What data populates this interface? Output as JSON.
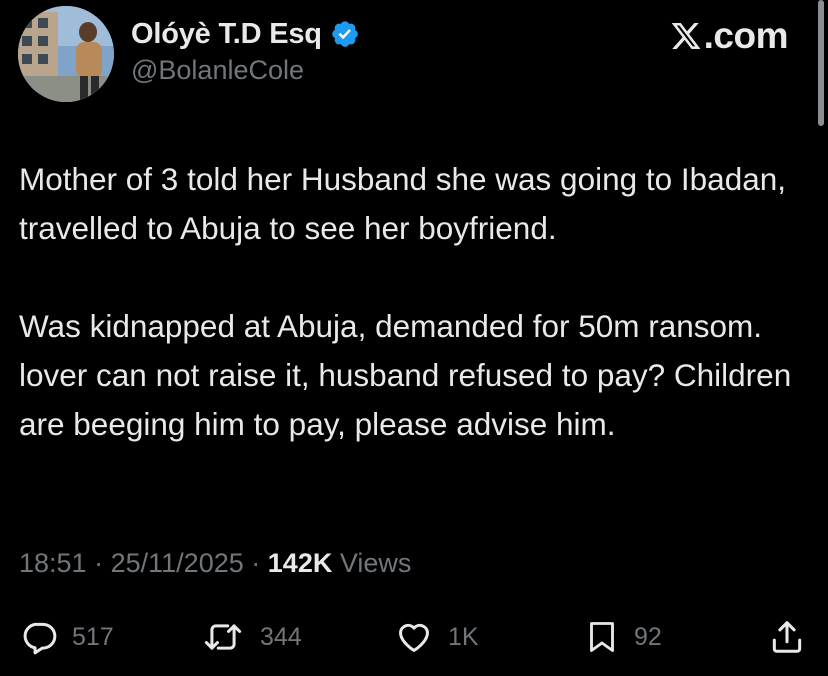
{
  "author": {
    "display_name": "Olóyè T.D Esq",
    "handle": "@BolanleCole",
    "verified": true,
    "avatar_icon": "profile-photo"
  },
  "brand": {
    "logo_icon": "x-logo-icon",
    "text": ".com"
  },
  "tweet": {
    "paragraphs": [
      "Mother of 3 told her Husband she was going to Ibadan, travelled to Abuja to see her boyfriend.",
      "Was kidnapped at Abuja, demanded for 50m ransom. lover can not raise it, husband refused to pay? Children are beeging him to pay, please advise him."
    ]
  },
  "meta": {
    "time": "18:51",
    "separator": "·",
    "date": "25/11/2025",
    "views_count": "142K",
    "views_label": "Views"
  },
  "actions": {
    "replies": "517",
    "reposts": "344",
    "likes": "1K",
    "bookmarks": "92"
  },
  "colors": {
    "background": "#000000",
    "text_primary": "#e7e9ea",
    "text_secondary": "#71767b",
    "verified_badge": "#1d9bf0"
  }
}
